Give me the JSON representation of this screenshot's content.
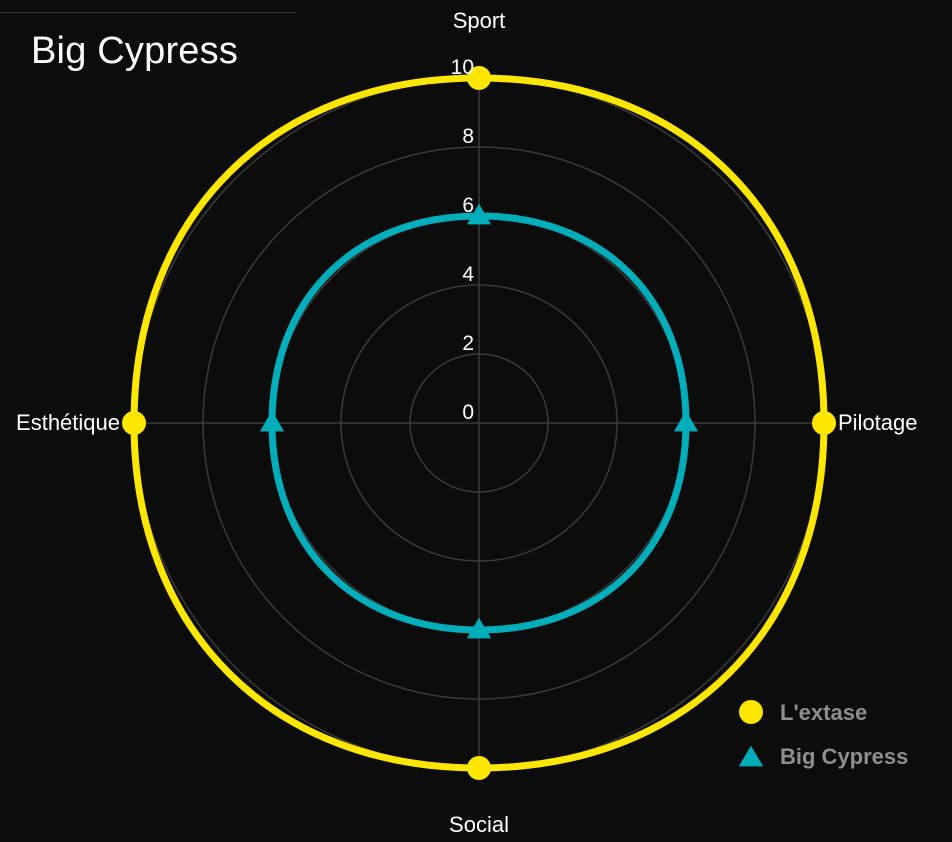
{
  "title": "Big Cypress",
  "colors": {
    "background": "#0c0c0c",
    "grid": "#3a3a3a",
    "series_lextase": "#ffe600",
    "series_bigcypress": "#00aebb"
  },
  "chart_data": {
    "type": "radar",
    "title": "Big Cypress",
    "axes": [
      "Sport",
      "Pilotage",
      "Social",
      "Esthétique"
    ],
    "ticks": [
      "0",
      "2",
      "4",
      "6",
      "8",
      "10"
    ],
    "rlim": [
      0,
      10
    ],
    "grid": true,
    "legend_position": "bottom-right",
    "series": [
      {
        "name": "L'extase",
        "values": [
          10,
          10,
          10,
          10
        ],
        "marker": "circle",
        "color": "#ffe600"
      },
      {
        "name": "Big Cypress",
        "values": [
          6,
          6,
          6,
          6
        ],
        "marker": "triangle",
        "color": "#00aebb"
      }
    ]
  }
}
